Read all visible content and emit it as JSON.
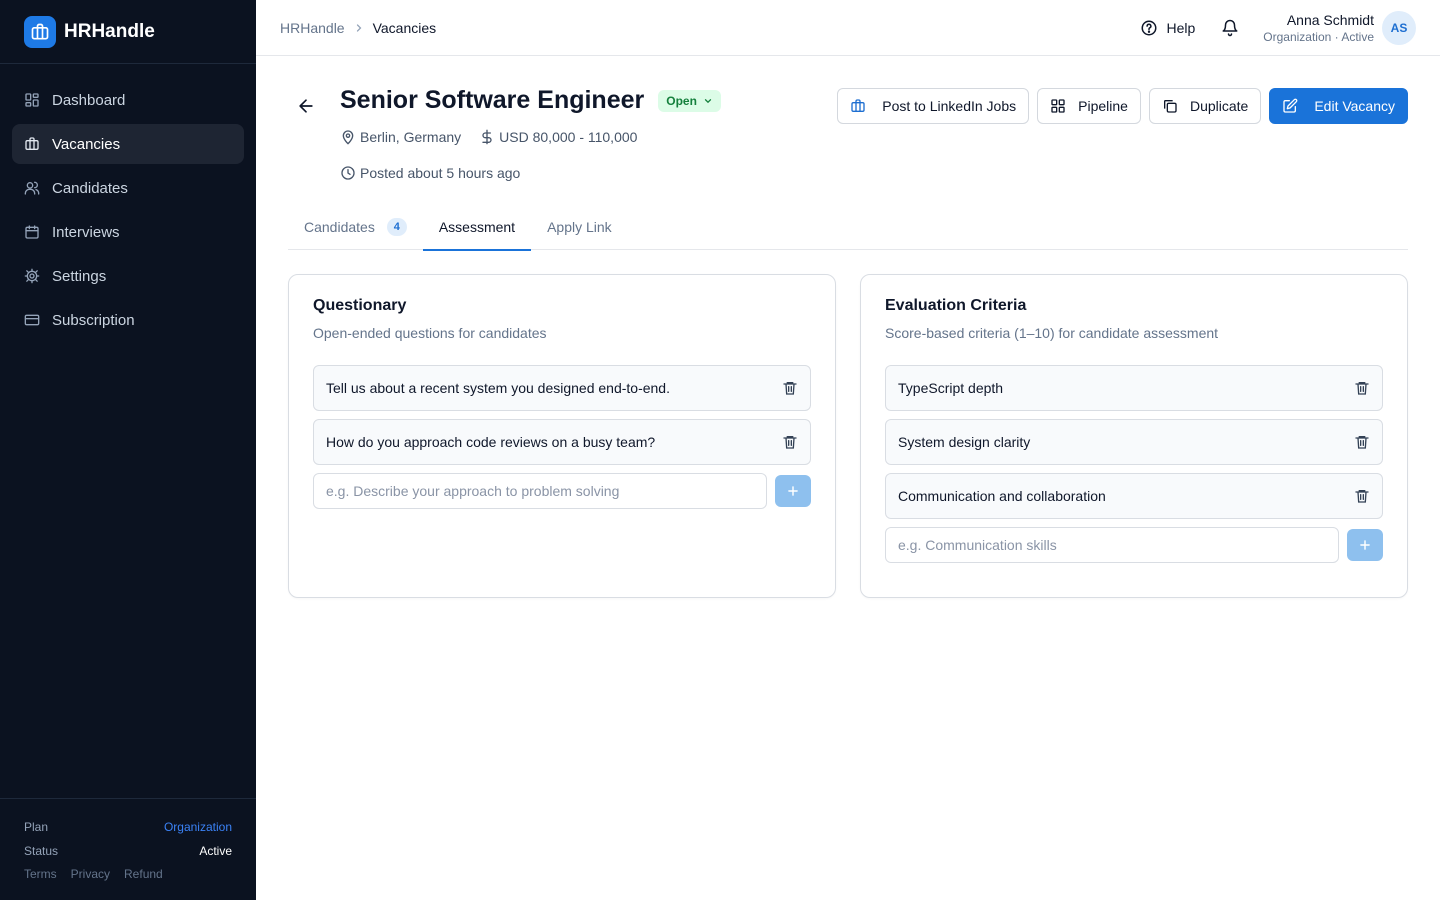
{
  "brand": {
    "name": "HRHandle",
    "icon": "briefcase-icon"
  },
  "sidebar": {
    "items": [
      {
        "label": "Dashboard",
        "icon": "dashboard-icon"
      },
      {
        "label": "Vacancies",
        "icon": "briefcase-icon",
        "active": true
      },
      {
        "label": "Candidates",
        "icon": "users-icon"
      },
      {
        "label": "Interviews",
        "icon": "calendar-icon"
      },
      {
        "label": "Settings",
        "icon": "gear-icon"
      },
      {
        "label": "Subscription",
        "icon": "credit-card-icon"
      }
    ],
    "footer": {
      "plan_label": "Plan",
      "plan_value": "Organization",
      "status_label": "Status",
      "status_value": "Active",
      "links": [
        "Terms",
        "Privacy",
        "Refund"
      ]
    }
  },
  "header": {
    "breadcrumb": {
      "root": "HRHandle",
      "current": "Vacancies"
    },
    "help_label": "Help",
    "user": {
      "name": "Anna Schmidt",
      "subtitle": "Organization · Active",
      "initials": "AS"
    }
  },
  "vacancy": {
    "title": "Senior Software Engineer",
    "status": "Open",
    "location": "Berlin, Germany",
    "salary": "USD 80,000 - 110,000",
    "posted": "Posted about 5 hours ago"
  },
  "actions": {
    "linkedin": "Post to LinkedIn Jobs",
    "pipeline": "Pipeline",
    "duplicate": "Duplicate",
    "edit": "Edit Vacancy"
  },
  "tabs": [
    {
      "label": "Candidates",
      "count": "4"
    },
    {
      "label": "Assessment",
      "active": true
    },
    {
      "label": "Apply Link"
    }
  ],
  "questionary": {
    "title": "Questionary",
    "subtitle": "Open-ended questions for candidates",
    "items": [
      "Tell us about a recent system you designed end-to-end.",
      "How do you approach code reviews on a busy team?"
    ],
    "placeholder": "e.g. Describe your approach to problem solving"
  },
  "criteria": {
    "title": "Evaluation Criteria",
    "subtitle": "Score-based criteria (1–10) for candidate assessment",
    "items": [
      "TypeScript depth",
      "System design clarity",
      "Communication and collaboration"
    ],
    "placeholder": "e.g. Communication skills"
  },
  "colors": {
    "sidebar_bg": "#0b1220",
    "primary": "#1a73d9",
    "status_open_bg": "#dcfce7",
    "status_open_fg": "#15803d"
  }
}
